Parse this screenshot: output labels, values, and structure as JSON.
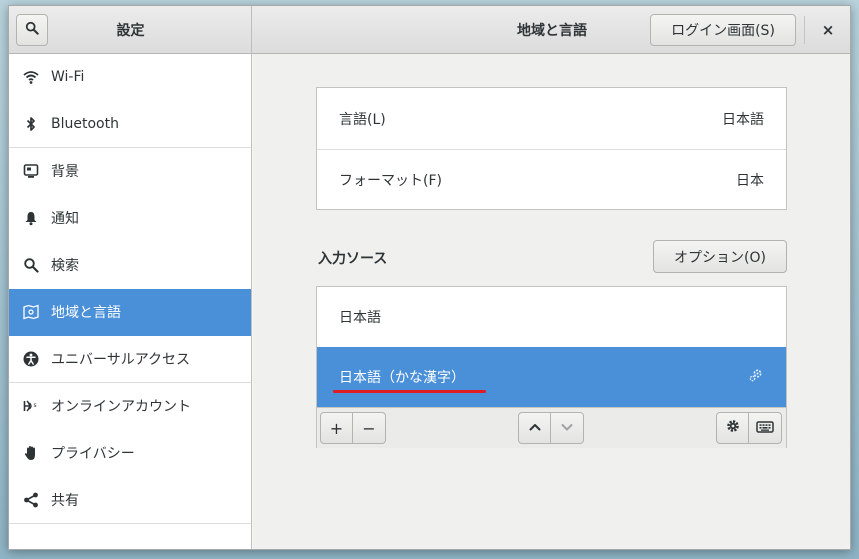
{
  "window": {
    "settings_title": "設定",
    "panel_title": "地域と言語",
    "login_button": "ログイン画面(S)",
    "close_glyph": "×"
  },
  "sidebar": {
    "items": [
      {
        "label": "Wi-Fi",
        "icon": "wifi-icon"
      },
      {
        "label": "Bluetooth",
        "icon": "bluetooth-icon"
      },
      {
        "label": "背景",
        "icon": "background-icon"
      },
      {
        "label": "通知",
        "icon": "bell-icon"
      },
      {
        "label": "検索",
        "icon": "search-icon"
      },
      {
        "label": "地域と言語",
        "icon": "region-icon",
        "active": true
      },
      {
        "label": "ユニバーサルアクセス",
        "icon": "accessibility-icon"
      },
      {
        "label": "オンラインアカウント",
        "icon": "online-accounts-icon"
      },
      {
        "label": "プライバシー",
        "icon": "hand-icon"
      },
      {
        "label": "共有",
        "icon": "share-icon"
      }
    ]
  },
  "language": {
    "language_label": "言語(L)",
    "language_value": "日本語",
    "format_label": "フォーマット(F)",
    "format_value": "日本"
  },
  "input_sources": {
    "title": "入力ソース",
    "options_button": "オプション(O)",
    "items": [
      "日本語",
      "日本語（かな漢字）"
    ],
    "selected_index": 1
  },
  "toolbar": {
    "add": "+",
    "remove": "−",
    "up": "⌃",
    "down": "⌄"
  },
  "colors": {
    "accent": "#4a90d9",
    "underline": "#e01b24"
  }
}
